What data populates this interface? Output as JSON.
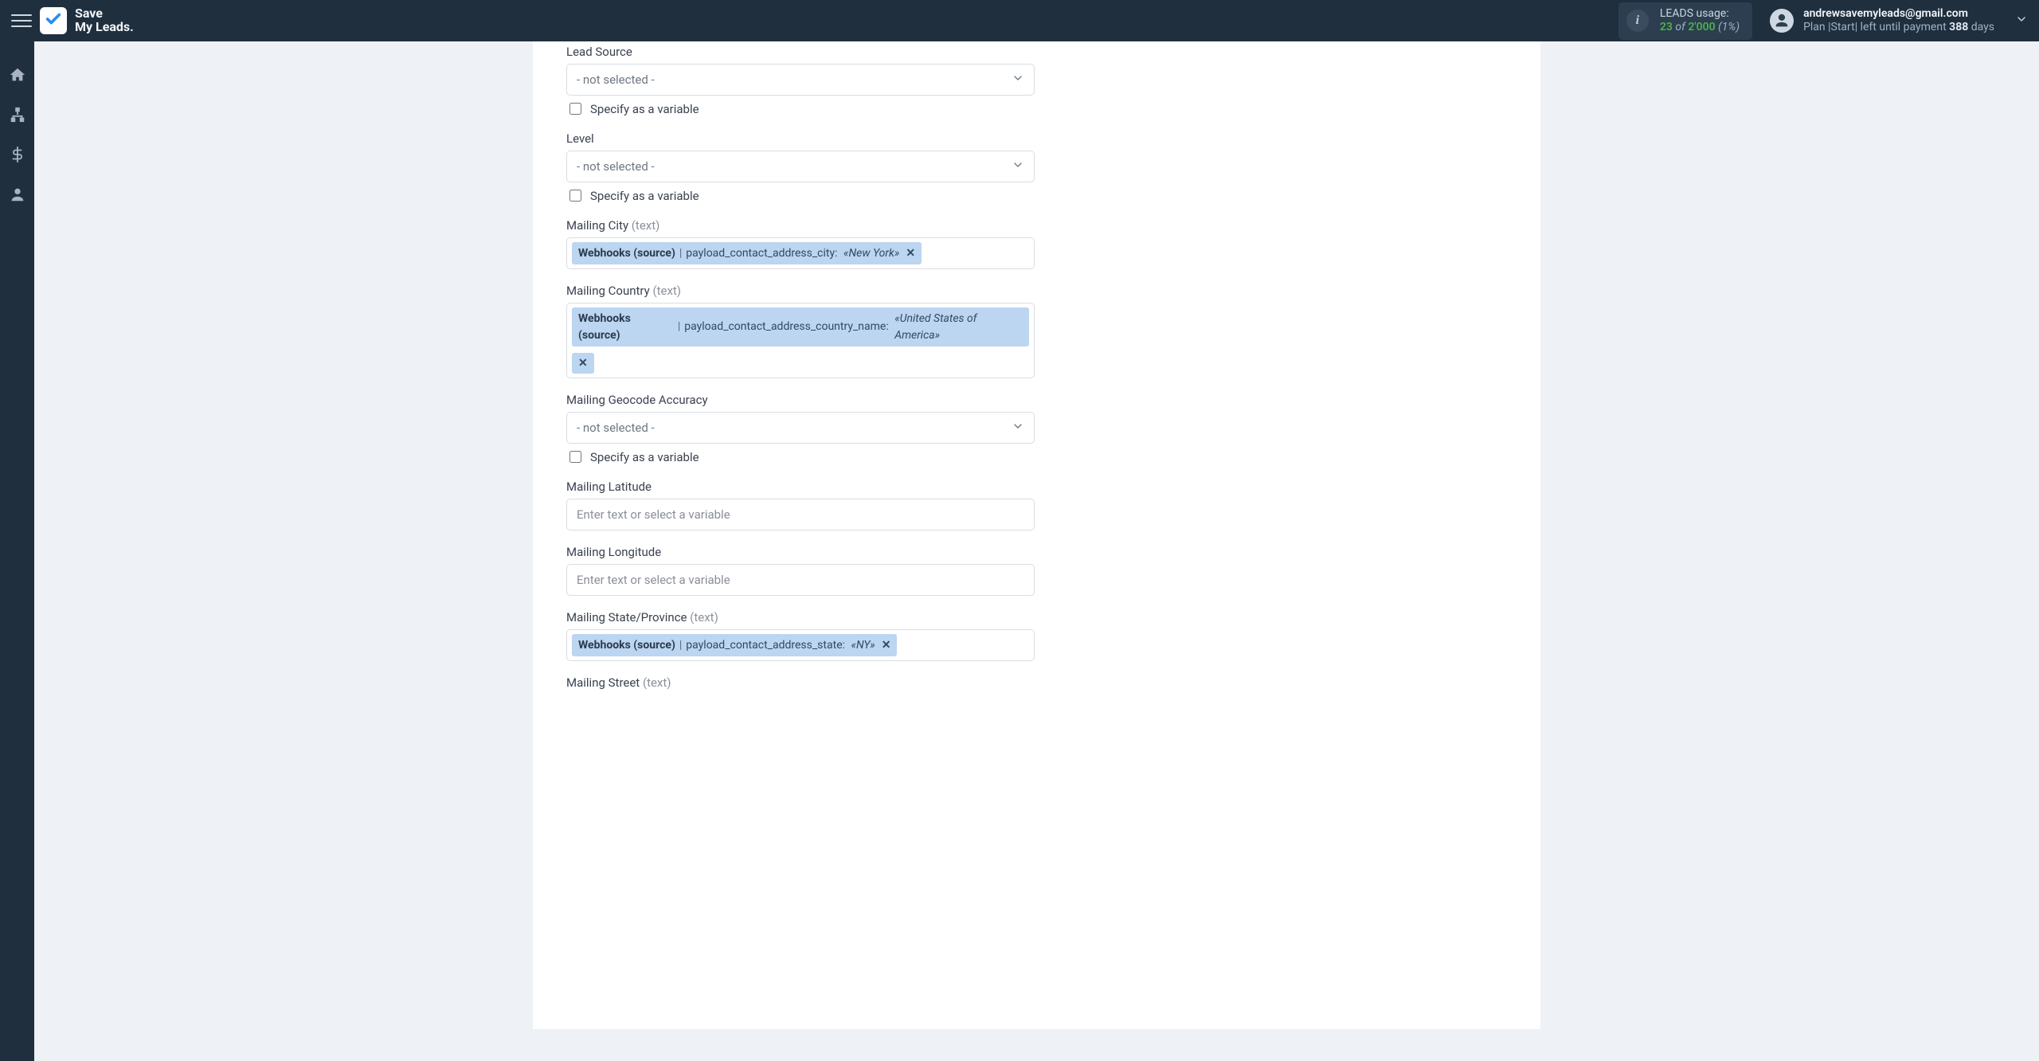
{
  "brand": {
    "l1": "Save",
    "l2": "My Leads."
  },
  "header": {
    "leads": {
      "label": "LEADS usage:",
      "used": "23",
      "of": "of",
      "total": "2'000",
      "pct": "(1%)"
    },
    "account": {
      "email": "andrewsavemyleads@gmail.com",
      "plan_prefix": "Plan |Start| left until payment ",
      "plan_days": "388",
      "plan_suffix": " days"
    }
  },
  "common": {
    "not_selected": "- not selected -",
    "specify_var": "Specify as a variable",
    "placeholder": "Enter text or select a variable",
    "text_hint": "(text)"
  },
  "fields": {
    "lead_source": {
      "label": "Lead Source"
    },
    "level": {
      "label": "Level"
    },
    "mailing_city": {
      "label": "Mailing City",
      "token": {
        "source": "Webhooks (source)",
        "path": "payload_contact_address_city:",
        "val": "«New York»"
      }
    },
    "mailing_country": {
      "label": "Mailing Country",
      "token": {
        "source": "Webhooks (source)",
        "path": "payload_contact_address_country_name:",
        "val": "«United States of America»"
      }
    },
    "mailing_geocode": {
      "label": "Mailing Geocode Accuracy"
    },
    "mailing_lat": {
      "label": "Mailing Latitude"
    },
    "mailing_lon": {
      "label": "Mailing Longitude"
    },
    "mailing_state": {
      "label": "Mailing State/Province",
      "token": {
        "source": "Webhooks (source)",
        "path": "payload_contact_address_state:",
        "val": "«NY»"
      }
    },
    "mailing_street": {
      "label": "Mailing Street"
    }
  }
}
